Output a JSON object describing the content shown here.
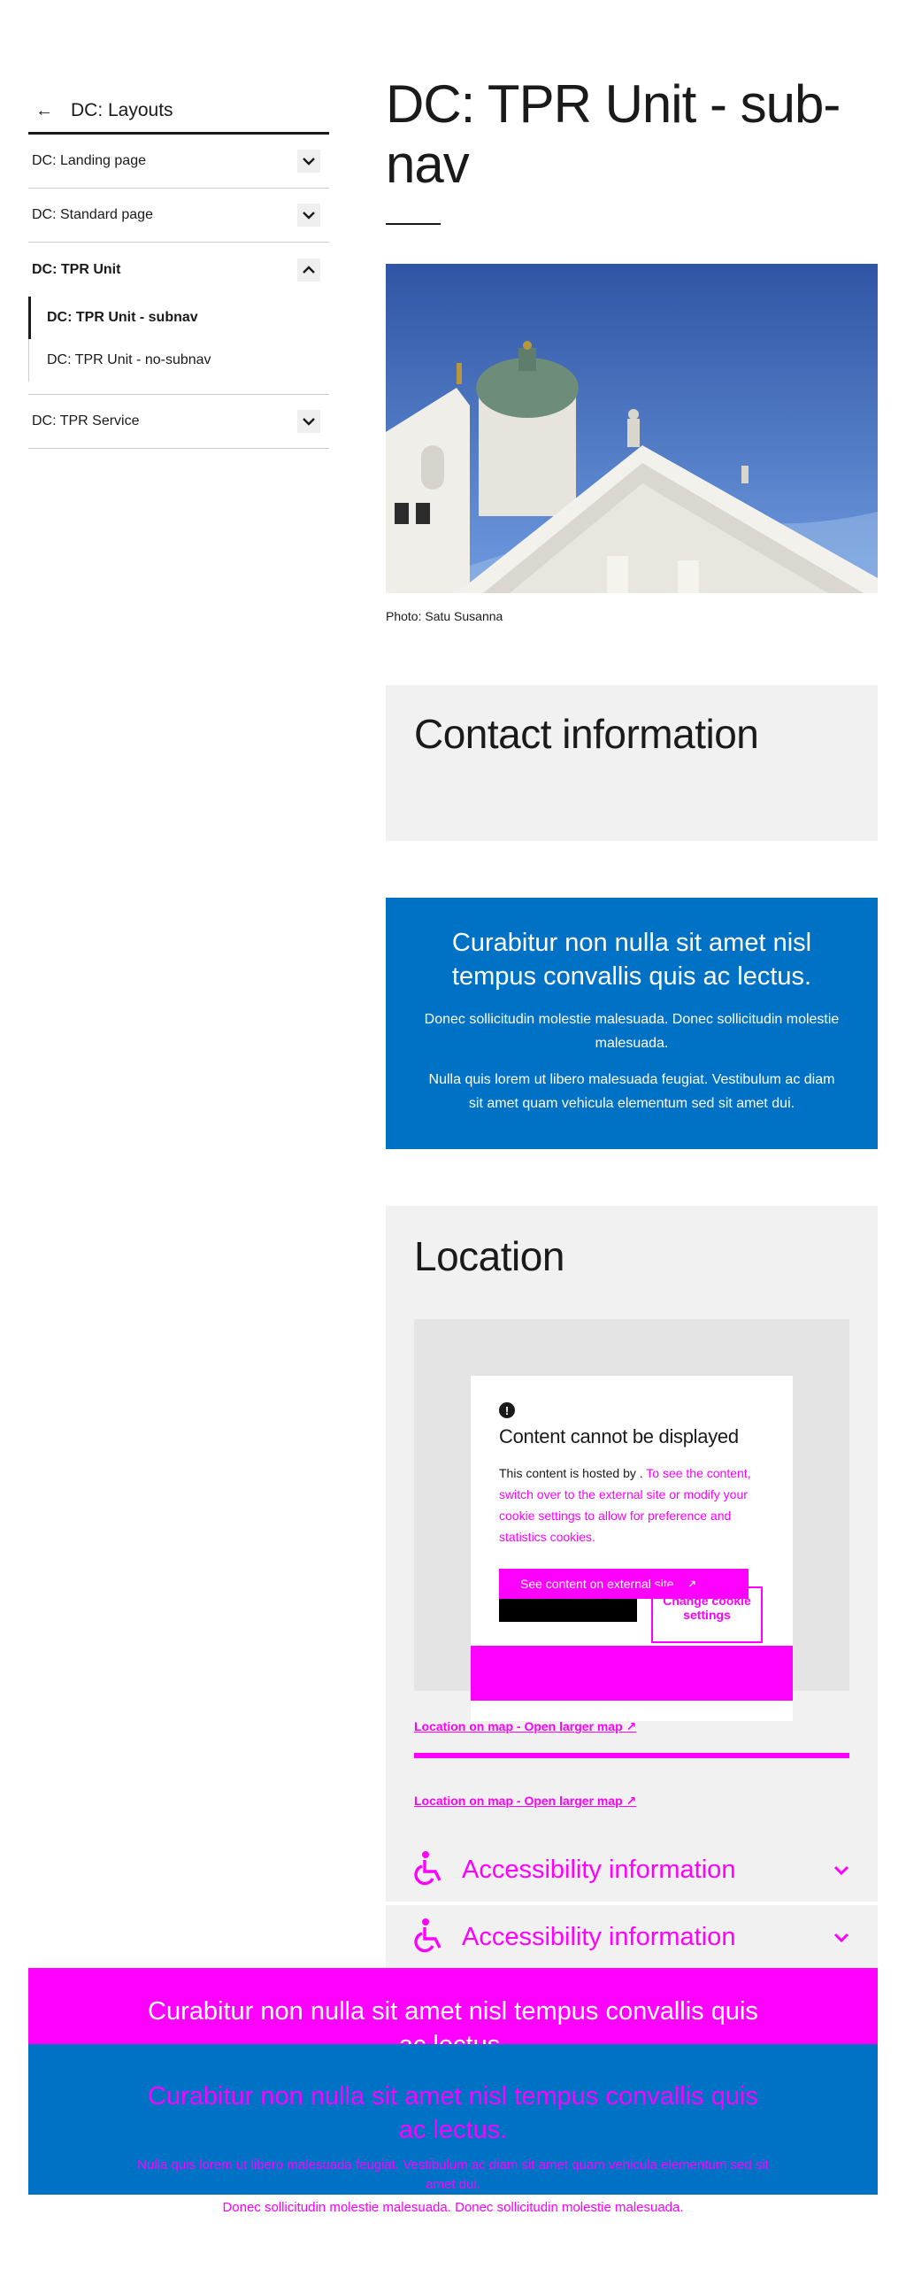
{
  "sidebar": {
    "back_label": "DC: Layouts",
    "items": [
      {
        "label": "DC: Landing page"
      },
      {
        "label": "DC: Standard page"
      },
      {
        "label": "DC: TPR Unit"
      },
      {
        "label": "DC: TPR Service"
      }
    ],
    "subnav": [
      {
        "label": "DC: TPR Unit - subnav"
      },
      {
        "label": "DC: TPR Unit - no-subnav"
      }
    ]
  },
  "main": {
    "title": "DC: TPR Unit - sub-nav",
    "photo_caption": "Photo: Satu Susanna",
    "contact_heading": "Contact information",
    "banner": {
      "heading": "Curabitur non nulla sit amet nisl tempus convallis quis ac lectus.",
      "paragraph1": "Donec sollicitudin molestie malesuada. Donec sollicitudin molestie malesuada.",
      "paragraph2": "Nulla quis lorem ut libero malesuada feugiat. Vestibulum ac diam sit amet quam vehicula elementum sed sit amet dui."
    },
    "location": {
      "heading": "Location",
      "consent_title": "Content cannot be displayed",
      "consent_text_prefix": "This content is hosted by .",
      "consent_text_highlight": "To see the content, switch over to the external site or modify your cookie settings to allow for preference and statistics cookies.",
      "external_button": "See content on external site",
      "cookie_button": "Change cookie settings",
      "map_link_1": "Location on map - Open larger map",
      "map_link_2": "Location on map - Open larger map"
    },
    "accessibility_label_1": "Accessibility information",
    "accessibility_label_2": "Accessibility information"
  },
  "bottom_banner": {
    "heading": "Curabitur non nulla sit amet nisl tempus convallis quis ac lectus.",
    "heading_overlap": "Curabitur non nulla sit amet nisl tempus convallis quis ac lectus.",
    "paragraph1": "Nulla quis lorem ut libero malesuada feugiat. Vestibulum ac diam sit amet quam vehicula elementum sed sit amet dui.",
    "paragraph2": "Donec sollicitudin molestie malesuada. Donec sollicitudin molestie malesuada."
  },
  "colors": {
    "brand_blue": "#0072c6",
    "debug_magenta": "#ff00ff",
    "panel_gray": "#f1f1f1"
  }
}
